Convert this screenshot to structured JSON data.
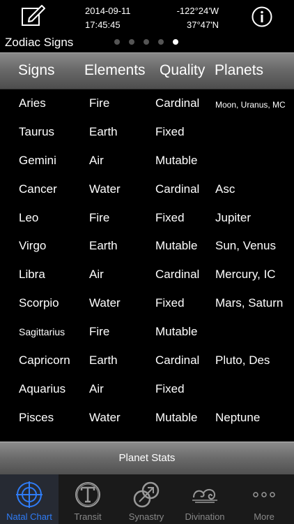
{
  "header": {
    "date": "2014-09-11",
    "time": "17:45:45",
    "longitude": "-122°24'W",
    "latitude": "37°47'N",
    "subtitle": "Zodiac Signs",
    "page_count": 5,
    "active_page": 5
  },
  "columns": [
    "Signs",
    "Elements",
    "Quality",
    "Planets"
  ],
  "rows": [
    {
      "sign": "Aries",
      "element": "Fire",
      "quality": "Cardinal",
      "planets": "Moon, Uranus, MC"
    },
    {
      "sign": "Taurus",
      "element": "Earth",
      "quality": "Fixed",
      "planets": ""
    },
    {
      "sign": "Gemini",
      "element": "Air",
      "quality": "Mutable",
      "planets": ""
    },
    {
      "sign": "Cancer",
      "element": "Water",
      "quality": "Cardinal",
      "planets": "Asc"
    },
    {
      "sign": "Leo",
      "element": "Fire",
      "quality": "Fixed",
      "planets": "Jupiter"
    },
    {
      "sign": "Virgo",
      "element": "Earth",
      "quality": "Mutable",
      "planets": "Sun, Venus"
    },
    {
      "sign": "Libra",
      "element": "Air",
      "quality": "Cardinal",
      "planets": "Mercury, IC"
    },
    {
      "sign": "Scorpio",
      "element": "Water",
      "quality": "Fixed",
      "planets": "Mars, Saturn"
    },
    {
      "sign": "Sagittarius",
      "element": "Fire",
      "quality": "Mutable",
      "planets": ""
    },
    {
      "sign": "Capricorn",
      "element": "Earth",
      "quality": "Cardinal",
      "planets": "Pluto, Des"
    },
    {
      "sign": "Aquarius",
      "element": "Air",
      "quality": "Fixed",
      "planets": ""
    },
    {
      "sign": "Pisces",
      "element": "Water",
      "quality": "Mutable",
      "planets": "Neptune"
    }
  ],
  "stats_button": "Planet Stats",
  "tabs": [
    {
      "label": "Natal Chart",
      "icon": "crosshair-circle-icon",
      "active": true
    },
    {
      "label": "Transit",
      "icon": "t-circle-icon",
      "active": false
    },
    {
      "label": "Synastry",
      "icon": "linked-circles-icon",
      "active": false
    },
    {
      "label": "Divination",
      "icon": "swirl-cloud-icon",
      "active": false
    },
    {
      "label": "More",
      "icon": "ellipsis-icon",
      "active": false
    }
  ],
  "colors": {
    "accent": "#2f7cf6",
    "inactive": "#888888"
  }
}
